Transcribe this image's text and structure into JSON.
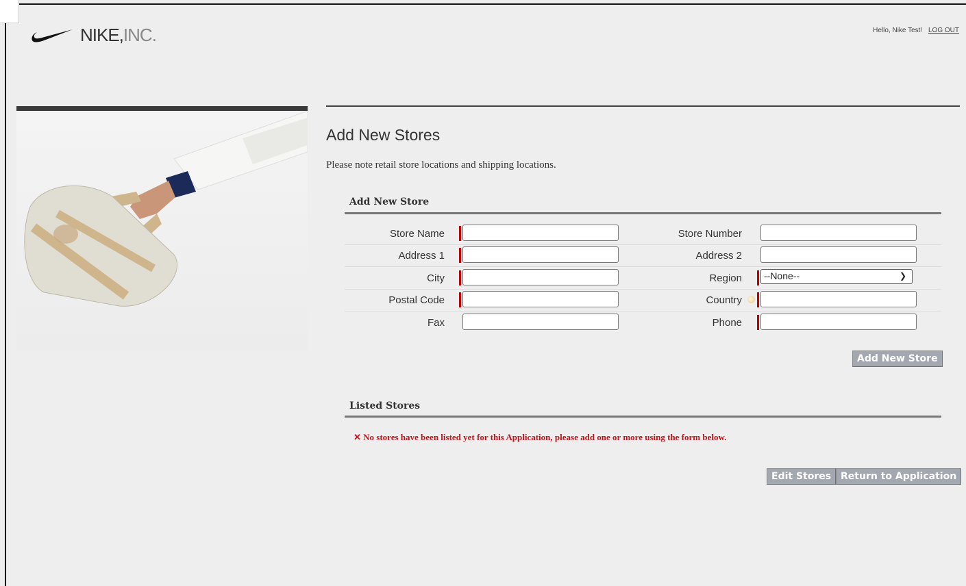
{
  "header": {
    "brand": "NIKE,",
    "brand_suffix": "INC.",
    "greeting": "Hello, Nike Test!",
    "logout_label": "LOG OUT"
  },
  "page": {
    "title": "Add New Stores",
    "note": "Please note retail store locations and shipping locations."
  },
  "add_store": {
    "section_title": "Add New Store",
    "fields": {
      "store_name": {
        "label": "Store Name",
        "value": "",
        "required": true
      },
      "store_number": {
        "label": "Store Number",
        "value": "",
        "required": false
      },
      "address1": {
        "label": "Address 1",
        "value": "",
        "required": true
      },
      "address2": {
        "label": "Address 2",
        "value": "",
        "required": false
      },
      "city": {
        "label": "City",
        "value": "",
        "required": true
      },
      "region": {
        "label": "Region",
        "value": "--None--",
        "required": true
      },
      "postal_code": {
        "label": "Postal Code",
        "value": "",
        "required": true
      },
      "country": {
        "label": "Country",
        "value": "",
        "required": true
      },
      "fax": {
        "label": "Fax",
        "value": "",
        "required": false
      },
      "phone": {
        "label": "Phone",
        "value": "",
        "required": true
      }
    },
    "submit_label": "Add New Store"
  },
  "listed_stores": {
    "section_title": "Listed Stores",
    "empty_message": "No stores have been listed yet for this Application, please add one or more using the form below.",
    "error_icon": "✕",
    "edit_label": "Edit Stores",
    "return_label": "Return to Application"
  },
  "colors": {
    "background": "#eeeeee",
    "required_marker": "#c00000",
    "error_text": "#c0141c",
    "button_bg": "#a3a8b0"
  }
}
